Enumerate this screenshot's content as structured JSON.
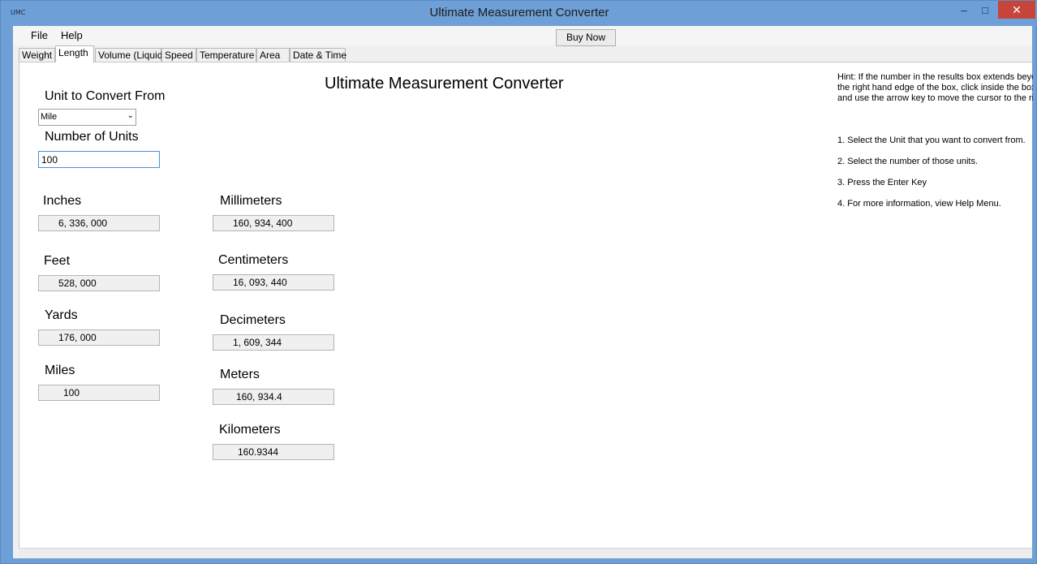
{
  "window": {
    "app_icon_text": "UMC",
    "title": "Ultimate Measurement Converter",
    "minimize_glyph": "–",
    "maximize_glyph": "□",
    "close_glyph": "✕"
  },
  "menu": {
    "file": "File",
    "help": "Help"
  },
  "toolbar": {
    "buy_now": "Buy Now"
  },
  "tabs": [
    {
      "label": "Weight"
    },
    {
      "label": "Length",
      "active": true
    },
    {
      "label": "Volume (Liquid)"
    },
    {
      "label": "Speed"
    },
    {
      "label": "Temperature"
    },
    {
      "label": "Area"
    },
    {
      "label": "Date & Time"
    }
  ],
  "panel": {
    "heading": "Ultimate Measurement Converter",
    "unit_from_label": "Unit to Convert From",
    "unit_from_value": "Mile",
    "num_units_label": "Number of Units",
    "num_units_value": "100"
  },
  "results": {
    "inches": {
      "label": "Inches",
      "value": "6, 336, 000"
    },
    "feet": {
      "label": "Feet",
      "value": "528, 000"
    },
    "yards": {
      "label": "Yards",
      "value": "176, 000"
    },
    "miles": {
      "label": "Miles",
      "value": "100"
    },
    "millimeters": {
      "label": "Millimeters",
      "value": "160, 934, 400"
    },
    "centimeters": {
      "label": "Centimeters",
      "value": "16, 093, 440"
    },
    "decimeters": {
      "label": "Decimeters",
      "value": "1, 609, 344"
    },
    "meters": {
      "label": "Meters",
      "value": "160, 934.4"
    },
    "kilometers": {
      "label": "Kilometers",
      "value": "160.9344"
    }
  },
  "hint": {
    "line1": "Hint: If the number in the results box extends beyon",
    "line2": "the right hand edge of the box, click inside the box",
    "line3": "and use the arrow key to move the cursor to the rig"
  },
  "steps": [
    "1. Select the Unit that you want to convert from.",
    "2. Select the number of those units.",
    "3. Press the Enter Key",
    "4. For more information, view Help Menu."
  ]
}
